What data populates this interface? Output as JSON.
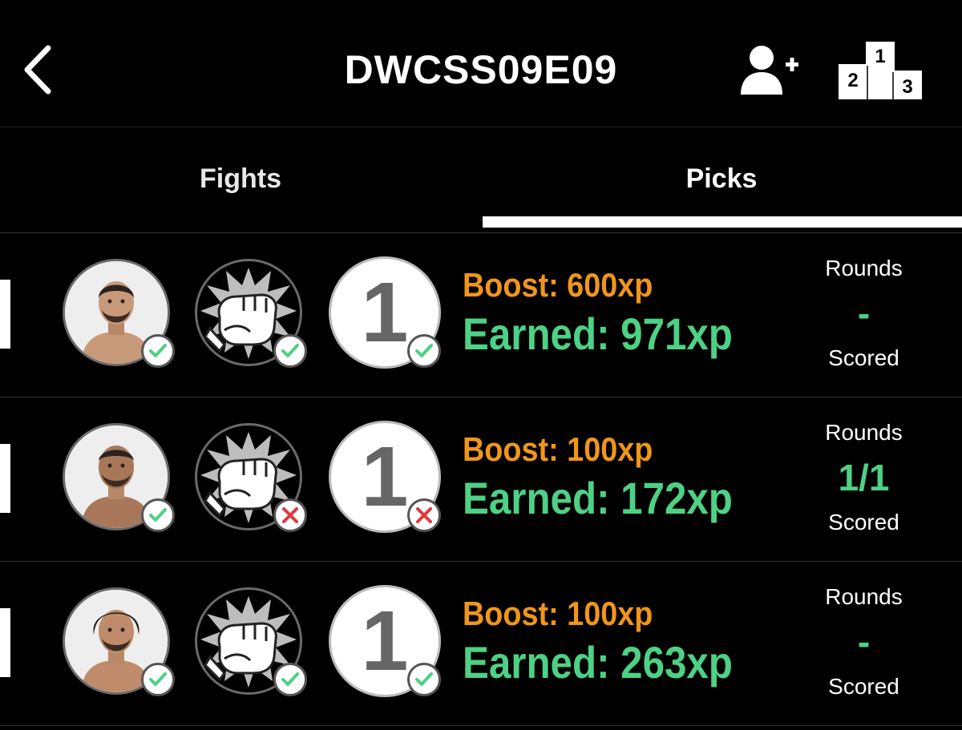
{
  "header": {
    "title": "DWCSS09E09",
    "back_icon": "chevron-left-icon",
    "add_user_icon": "add-user-icon",
    "leaderboard_icon": "podium-icon",
    "podium_labels": [
      "1",
      "2",
      "3"
    ]
  },
  "tabs": [
    {
      "label": "Fights",
      "selected": false
    },
    {
      "label": "Picks",
      "selected": true
    }
  ],
  "colors": {
    "boost": "#f0961a",
    "earned": "#4dd184",
    "correct": "#4dd184",
    "incorrect": "#e0383e"
  },
  "picks": [
    {
      "fighter_correct": true,
      "method_icon": "punch-icon",
      "method_correct": true,
      "round": "1",
      "round_correct": true,
      "boost": "Boost: 600xp",
      "earned": "Earned: 971xp",
      "rounds_label": "Rounds",
      "rounds_value": "-",
      "scored_label": "Scored"
    },
    {
      "fighter_correct": true,
      "method_icon": "punch-icon",
      "method_correct": false,
      "round": "1",
      "round_correct": false,
      "boost": "Boost: 100xp",
      "earned": "Earned: 172xp",
      "rounds_label": "Rounds",
      "rounds_value": "1/1",
      "scored_label": "Scored"
    },
    {
      "fighter_correct": true,
      "method_icon": "punch-icon",
      "method_correct": true,
      "round": "1",
      "round_correct": true,
      "boost": "Boost: 100xp",
      "earned": "Earned: 263xp",
      "rounds_label": "Rounds",
      "rounds_value": "-",
      "scored_label": "Scored"
    }
  ]
}
